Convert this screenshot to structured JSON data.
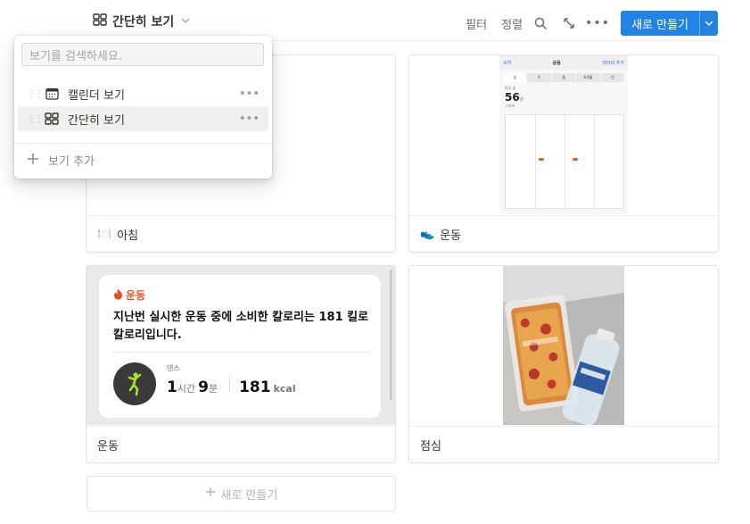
{
  "header": {
    "current_view": "간단히 보기",
    "filter_label": "필터",
    "sort_label": "정렬",
    "new_label": "새로 만들기"
  },
  "cards": [
    {
      "title": "아침",
      "emoji": "🍽️"
    },
    {
      "title": "운동",
      "emoji": "👟"
    },
    {
      "title": "운동",
      "emoji": ""
    },
    {
      "title": "점심",
      "emoji": ""
    }
  ],
  "phone_screenshot": {
    "back": "요약",
    "title": "운동",
    "action": "데이터 추가",
    "segments": [
      "일",
      "주",
      "월",
      "6개월",
      "년"
    ],
    "metric_label": "평균 총",
    "metric_value": "56",
    "metric_unit": "분",
    "range_label": "그제께"
  },
  "workout": {
    "header": "운동",
    "message": "지난번 실시한 운동 중에 소비한 칼로리는 181 킬로칼로리입니다.",
    "type": "댄스",
    "hours": "1",
    "hours_unit": "시간",
    "minutes": "9",
    "minutes_unit": "분",
    "kcal": "181",
    "kcal_unit": "kcal"
  },
  "new_row_label": "새로 만들기",
  "dropdown": {
    "search_placeholder": "보기를 검색하세요.",
    "items": [
      {
        "label": "캘린더 보기",
        "icon": "calendar-icon"
      },
      {
        "label": "간단히 보기",
        "icon": "gallery-icon"
      }
    ],
    "add_label": "보기 추가"
  },
  "colors": {
    "accent": "#2383e2",
    "workout_orange": "#e8511f",
    "dance_green": "#a6e22e"
  }
}
